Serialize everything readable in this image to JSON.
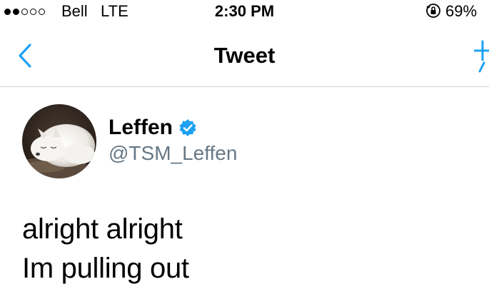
{
  "status_bar": {
    "carrier": "Bell   LTE",
    "time": "2:30 PM",
    "battery": "69%",
    "signal_icon": "signal-dots-icon",
    "rotation_lock_icon": "rotation-lock-icon"
  },
  "nav": {
    "title": "Tweet",
    "back_icon": "chevron-left-icon",
    "compose_icon": "plus-icon",
    "accent_color": "#1DA1F2"
  },
  "tweet": {
    "author": {
      "display_name": "Leffen",
      "handle": "@TSM_Leffen",
      "verified": true,
      "avatar_icon": "arctic-fox-avatar"
    },
    "lines": [
      "alright alright",
      "Im pulling out"
    ]
  },
  "colors": {
    "background": "#FFFFFF",
    "text": "#000000",
    "secondary_text": "#657786",
    "divider": "#D0D0D4",
    "verified_badge": "#1DA1F2"
  }
}
